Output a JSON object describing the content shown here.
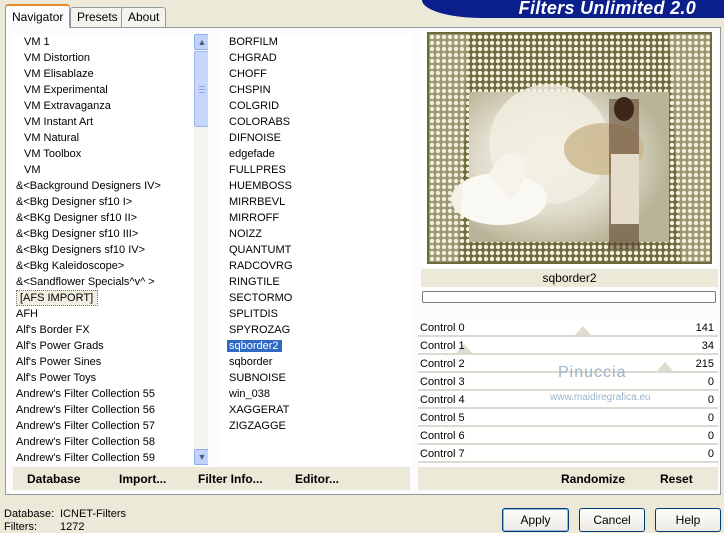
{
  "tabs": [
    "Navigator",
    "Presets",
    "About"
  ],
  "banner_title": "Filters Unlimited 2.0",
  "categories": [
    "VM 1",
    "VM Distortion",
    "VM Elisablaze",
    "VM Experimental",
    "VM Extravaganza",
    "VM Instant Art",
    "VM Natural",
    "VM Toolbox",
    "VM",
    "&<Background Designers IV>",
    "&<Bkg Designer sf10 I>",
    "&<BKg Designer sf10 II>",
    "&<Bkg Designer sf10 III>",
    "&<Bkg Designers sf10 IV>",
    "&<Bkg Kaleidoscope>",
    "&<Sandflower Specials^v^ >",
    "[AFS IMPORT]",
    "AFH",
    "Alf's Border FX",
    "Alf's Power Grads",
    "Alf's Power Sines",
    "Alf's Power Toys",
    "Andrew's Filter Collection 55",
    "Andrew's Filter Collection 56",
    "Andrew's Filter Collection 57",
    "Andrew's Filter Collection 58",
    "Andrew's Filter Collection 59"
  ],
  "selected_category": "[AFS IMPORT]",
  "filters": [
    "BORFILM",
    "CHGRAD",
    "CHOFF",
    "CHSPIN",
    "COLGRID",
    "COLORABS",
    "DIFNOISE",
    "edgefade",
    "FULLPRES",
    "HUEMBOSS",
    "MIRRBEVL",
    "MIRROFF",
    "NOIZZ",
    "QUANTUMT",
    "RADCOVRG",
    "RINGTILE",
    "SECTORMO",
    "SPLITDIS",
    "SPYROZAG",
    "sqborder2",
    "sqborder",
    "SUBNOISE",
    "win_038",
    "XAGGERAT",
    "ZIGZAGGE"
  ],
  "selected_filter": "sqborder2",
  "preview_filter_name": "sqborder2",
  "controls": [
    {
      "label": "Control 0",
      "value": "141",
      "level": 0.553
    },
    {
      "label": "Control 1",
      "value": "34",
      "level": 0.133
    },
    {
      "label": "Control 2",
      "value": "215",
      "level": 0.843
    },
    {
      "label": "Control 3",
      "value": "0",
      "level": 0
    },
    {
      "label": "Control 4",
      "value": "0",
      "level": 0
    },
    {
      "label": "Control 5",
      "value": "0",
      "level": 0
    },
    {
      "label": "Control 6",
      "value": "0",
      "level": 0
    },
    {
      "label": "Control 7",
      "value": "0",
      "level": 0
    }
  ],
  "watermark": {
    "name": "Pinuccia",
    "url": "www.maidiregrafica.eu"
  },
  "toolbar": {
    "database": "Database",
    "import": "Import...",
    "filter_info": "Filter Info...",
    "editor": "Editor...",
    "randomize": "Randomize",
    "reset": "Reset"
  },
  "status": {
    "database_label": "Database:",
    "database_value": "ICNET-Filters",
    "filters_label": "Filters:",
    "filters_value": "1272"
  },
  "buttons": {
    "apply": "Apply",
    "cancel": "Cancel",
    "help": "Help"
  },
  "colors": {
    "banner": "#0b1f8c",
    "selection": "#316ac5",
    "tab_highlight": "#e68b2c"
  }
}
